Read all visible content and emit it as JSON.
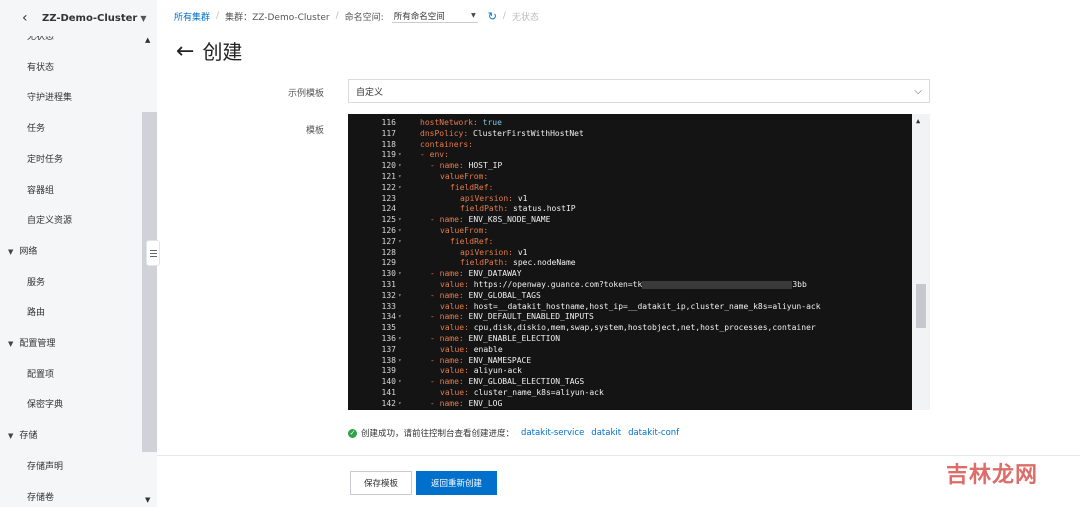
{
  "sidebar": {
    "cluster_name": "ZZ-Demo-Cluster",
    "items": [
      {
        "label": "无状态",
        "kind": "item"
      },
      {
        "label": "有状态",
        "kind": "item"
      },
      {
        "label": "守护进程集",
        "kind": "item"
      },
      {
        "label": "任务",
        "kind": "item"
      },
      {
        "label": "定时任务",
        "kind": "item"
      },
      {
        "label": "容器组",
        "kind": "item"
      },
      {
        "label": "自定义资源",
        "kind": "item"
      },
      {
        "label": "网络",
        "kind": "group"
      },
      {
        "label": "服务",
        "kind": "item"
      },
      {
        "label": "路由",
        "kind": "item"
      },
      {
        "label": "配置管理",
        "kind": "group"
      },
      {
        "label": "配置项",
        "kind": "item"
      },
      {
        "label": "保密字典",
        "kind": "item"
      },
      {
        "label": "存储",
        "kind": "group"
      },
      {
        "label": "存储声明",
        "kind": "item"
      },
      {
        "label": "存储卷",
        "kind": "item"
      }
    ]
  },
  "breadcrumb": {
    "all_clusters": "所有集群",
    "cluster": "集群：ZZ-Demo-Cluster",
    "namespace_label": "命名空间:",
    "namespace_value": "所有命名空间",
    "status": "无状态"
  },
  "page": {
    "title": "创建",
    "example_template_label": "示例模板",
    "example_template_value": "自定义",
    "template_label": "模板"
  },
  "editor": {
    "lines": [
      {
        "n": "116",
        "fold": false,
        "indent": 1,
        "key": "hostNetwork:",
        "val": "true",
        "valKind": "bool"
      },
      {
        "n": "117",
        "fold": false,
        "indent": 1,
        "key": "dnsPolicy:",
        "val": "ClusterFirstWithHostNet",
        "valKind": "str"
      },
      {
        "n": "118",
        "fold": false,
        "indent": 1,
        "key": "containers:",
        "val": "",
        "valKind": "str"
      },
      {
        "n": "119",
        "fold": true,
        "indent": 1,
        "key": "- env:",
        "val": "",
        "valKind": "str"
      },
      {
        "n": "120",
        "fold": true,
        "indent": 2,
        "key": "- name:",
        "val": "HOST_IP",
        "valKind": "str"
      },
      {
        "n": "121",
        "fold": true,
        "indent": 3,
        "key": "valueFrom:",
        "val": "",
        "valKind": "str"
      },
      {
        "n": "122",
        "fold": true,
        "indent": 4,
        "key": "fieldRef:",
        "val": "",
        "valKind": "str"
      },
      {
        "n": "123",
        "fold": false,
        "indent": 5,
        "key": "apiVersion:",
        "val": "v1",
        "valKind": "str"
      },
      {
        "n": "124",
        "fold": false,
        "indent": 5,
        "key": "fieldPath:",
        "val": "status.hostIP",
        "valKind": "str"
      },
      {
        "n": "125",
        "fold": true,
        "indent": 2,
        "key": "- name:",
        "val": "ENV_K8S_NODE_NAME",
        "valKind": "str"
      },
      {
        "n": "126",
        "fold": true,
        "indent": 3,
        "key": "valueFrom:",
        "val": "",
        "valKind": "str"
      },
      {
        "n": "127",
        "fold": true,
        "indent": 4,
        "key": "fieldRef:",
        "val": "",
        "valKind": "str"
      },
      {
        "n": "128",
        "fold": false,
        "indent": 5,
        "key": "apiVersion:",
        "val": "v1",
        "valKind": "str"
      },
      {
        "n": "129",
        "fold": false,
        "indent": 5,
        "key": "fieldPath:",
        "val": "spec.nodeName",
        "valKind": "str"
      },
      {
        "n": "130",
        "fold": true,
        "indent": 2,
        "key": "- name:",
        "val": "ENV_DATAWAY",
        "valKind": "str"
      },
      {
        "n": "131",
        "fold": false,
        "indent": 3,
        "key": "value:",
        "val": "https://openway.guance.com?token=tk",
        "valKind": "masked",
        "tail": "3bb"
      },
      {
        "n": "132",
        "fold": true,
        "indent": 2,
        "key": "- name:",
        "val": "ENV_GLOBAL_TAGS",
        "valKind": "str"
      },
      {
        "n": "133",
        "fold": false,
        "indent": 3,
        "key": "value:",
        "val": "host=__datakit_hostname,host_ip=__datakit_ip,cluster_name_k8s=aliyun-ack",
        "valKind": "str"
      },
      {
        "n": "134",
        "fold": true,
        "indent": 2,
        "key": "- name:",
        "val": "ENV_DEFAULT_ENABLED_INPUTS",
        "valKind": "str"
      },
      {
        "n": "135",
        "fold": false,
        "indent": 3,
        "key": "value:",
        "val": "cpu,disk,diskio,mem,swap,system,hostobject,net,host_processes,container",
        "valKind": "str"
      },
      {
        "n": "136",
        "fold": true,
        "indent": 2,
        "key": "- name:",
        "val": "ENV_ENABLE_ELECTION",
        "valKind": "str"
      },
      {
        "n": "137",
        "fold": false,
        "indent": 3,
        "key": "value:",
        "val": "enable",
        "valKind": "str"
      },
      {
        "n": "138",
        "fold": true,
        "indent": 2,
        "key": "- name:",
        "val": "ENV_NAMESPACE",
        "valKind": "str"
      },
      {
        "n": "139",
        "fold": false,
        "indent": 3,
        "key": "value:",
        "val": "aliyun-ack",
        "valKind": "str"
      },
      {
        "n": "140",
        "fold": true,
        "indent": 2,
        "key": "- name:",
        "val": "ENV_GLOBAL_ELECTION_TAGS",
        "valKind": "str"
      },
      {
        "n": "141",
        "fold": false,
        "indent": 3,
        "key": "value:",
        "val": "cluster_name_k8s=aliyun-ack",
        "valKind": "str"
      },
      {
        "n": "142",
        "fold": true,
        "indent": 2,
        "key": "- name:",
        "val": "ENV_LOG",
        "valKind": "str"
      }
    ]
  },
  "result": {
    "message": "创建成功，请前往控制台查看创建进度：",
    "links": [
      "datakit-service",
      "datakit",
      "datakit-conf"
    ]
  },
  "actions": {
    "save_template": "保存模板",
    "back_recreate": "返回重新创建"
  },
  "watermark": "吉林龙网"
}
